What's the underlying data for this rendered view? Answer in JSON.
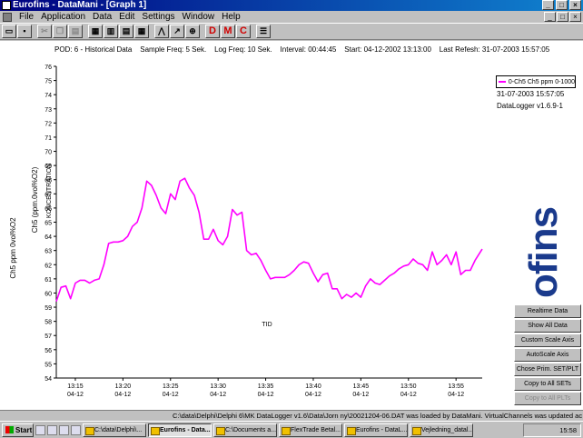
{
  "window": {
    "title": "Eurofins - DataMani - [Graph 1]",
    "btn_min": "_",
    "btn_max": "□",
    "btn_close": "×"
  },
  "menu": [
    "File",
    "Application",
    "Data",
    "Edit",
    "Settings",
    "Window",
    "Help"
  ],
  "toolbar": {
    "d_label": "D",
    "m_label": "M",
    "c_label": "C"
  },
  "info": {
    "pod": "POD: 6 - Historical Data",
    "sample": "Sample Freq: 5 Sek.",
    "log": "Log Freq: 10 Sek.",
    "interval": "Interval: 00:44:45",
    "start": "Start: 04-12-2002 13:13:00",
    "refresh": "Last Refesh: 31-07-2003 15:57:05"
  },
  "legend": {
    "entry": "0-Ch5 Ch5 ppm 0-1000",
    "date": "31-07-2003 15:57:05",
    "version": "DataLogger v1.6.9-1"
  },
  "logo": "ofins",
  "controls": [
    "Realtime Data",
    "Show All Data",
    "Custom Scale Axis",
    "AutoScale Axis",
    "Chose Prim. SET/PLT",
    "Copy to All SETs",
    "Copy to All PLTs"
  ],
  "statusbar": "C:\\data\\Delphi\\Delphi 6\\MK DataLogger v1.6\\Data\\Jorn ny\\20021204-06.DAT was loaded by DataMani.  VirtualChannels was updated ac",
  "taskbar": {
    "start": "Start",
    "tasks": [
      "C:\\data\\Delphi\\...",
      "Eurofins - Data...",
      "C:\\Documents a...",
      "FlexTrade Betal...",
      "Eurofins - DataL...",
      "Vejledning_datal..."
    ],
    "clock": "15:58"
  },
  "colors": {
    "series": "#ff00ff",
    "logo": "#1a3a8c"
  },
  "chart_data": {
    "type": "line",
    "ylabel": "Ch5 ppm 0vol%O2",
    "ylabel2": "Ch5 (ppm.0vol%O2)",
    "ylabel3": "KONCENTRATION",
    "xlabel": "TID",
    "ylim": [
      54,
      76
    ],
    "xlim": [
      "13:13:00",
      "13:57:45"
    ],
    "yticks": [
      54,
      55,
      56,
      57,
      58,
      59,
      60,
      61,
      62,
      63,
      64,
      65,
      66,
      67,
      68,
      69,
      70,
      71,
      72,
      73,
      74,
      75,
      76
    ],
    "xticks": [
      {
        "t": "13:15",
        "d": "04-12"
      },
      {
        "t": "13:20",
        "d": "04-12"
      },
      {
        "t": "13:25",
        "d": "04-12"
      },
      {
        "t": "13:30",
        "d": "04-12"
      },
      {
        "t": "13:35",
        "d": "04-12"
      },
      {
        "t": "13:40",
        "d": "04-12"
      },
      {
        "t": "13:45",
        "d": "04-12"
      },
      {
        "t": "13:50",
        "d": "04-12"
      },
      {
        "t": "13:55",
        "d": "04-12"
      }
    ],
    "series": [
      {
        "name": "0-Ch5 Ch5 ppm 0-1000",
        "x": [
          "13:13:00",
          "13:13:30",
          "13:14:00",
          "13:14:30",
          "13:15:00",
          "13:15:30",
          "13:16:00",
          "13:16:30",
          "13:17:00",
          "13:17:30",
          "13:18:00",
          "13:18:30",
          "13:19:00",
          "13:19:30",
          "13:20:00",
          "13:20:30",
          "13:21:00",
          "13:21:30",
          "13:22:00",
          "13:22:30",
          "13:23:00",
          "13:23:30",
          "13:24:00",
          "13:24:30",
          "13:25:00",
          "13:25:30",
          "13:26:00",
          "13:26:30",
          "13:27:00",
          "13:27:30",
          "13:28:00",
          "13:28:30",
          "13:29:00",
          "13:29:30",
          "13:30:00",
          "13:30:30",
          "13:31:00",
          "13:31:30",
          "13:32:00",
          "13:32:30",
          "13:33:00",
          "13:33:30",
          "13:34:00",
          "13:34:30",
          "13:35:00",
          "13:35:30",
          "13:36:00",
          "13:36:30",
          "13:37:00",
          "13:37:30",
          "13:38:00",
          "13:38:30",
          "13:39:00",
          "13:39:30",
          "13:40:00",
          "13:40:30",
          "13:41:00",
          "13:41:30",
          "13:42:00",
          "13:42:30",
          "13:43:00",
          "13:43:30",
          "13:44:00",
          "13:44:30",
          "13:45:00",
          "13:45:30",
          "13:46:00",
          "13:46:30",
          "13:47:00",
          "13:47:30",
          "13:48:00",
          "13:48:30",
          "13:49:00",
          "13:49:30",
          "13:50:00",
          "13:50:30",
          "13:51:00",
          "13:51:30",
          "13:52:00",
          "13:52:30",
          "13:53:00",
          "13:53:30",
          "13:54:00",
          "13:54:30",
          "13:55:00",
          "13:55:30",
          "13:56:00",
          "13:56:30",
          "13:57:00",
          "13:57:45"
        ],
        "y": [
          59.4,
          60.4,
          60.5,
          59.6,
          60.7,
          60.9,
          60.9,
          60.7,
          60.9,
          61.0,
          62.0,
          63.5,
          63.6,
          63.6,
          63.7,
          64.0,
          64.7,
          65.0,
          66.0,
          67.9,
          67.6,
          66.9,
          66.0,
          65.6,
          67.0,
          66.6,
          67.9,
          68.1,
          67.4,
          66.9,
          65.7,
          63.8,
          63.8,
          64.5,
          63.7,
          63.4,
          64.0,
          65.9,
          65.5,
          65.7,
          63.0,
          62.7,
          62.8,
          62.3,
          61.6,
          61.0,
          61.1,
          61.1,
          61.1,
          61.3,
          61.6,
          62.0,
          62.2,
          62.1,
          61.4,
          60.8,
          61.3,
          61.4,
          60.3,
          60.3,
          59.6,
          59.9,
          59.7,
          60.0,
          59.7,
          60.5,
          61.0,
          60.7,
          60.6,
          60.9,
          61.2,
          61.4,
          61.7,
          61.9,
          62.0,
          62.4,
          62.1,
          62.0,
          61.6,
          62.9,
          62.0,
          62.3,
          62.7,
          62.0,
          62.9,
          61.3,
          61.6,
          61.6,
          62.3,
          63.1
        ]
      }
    ]
  }
}
